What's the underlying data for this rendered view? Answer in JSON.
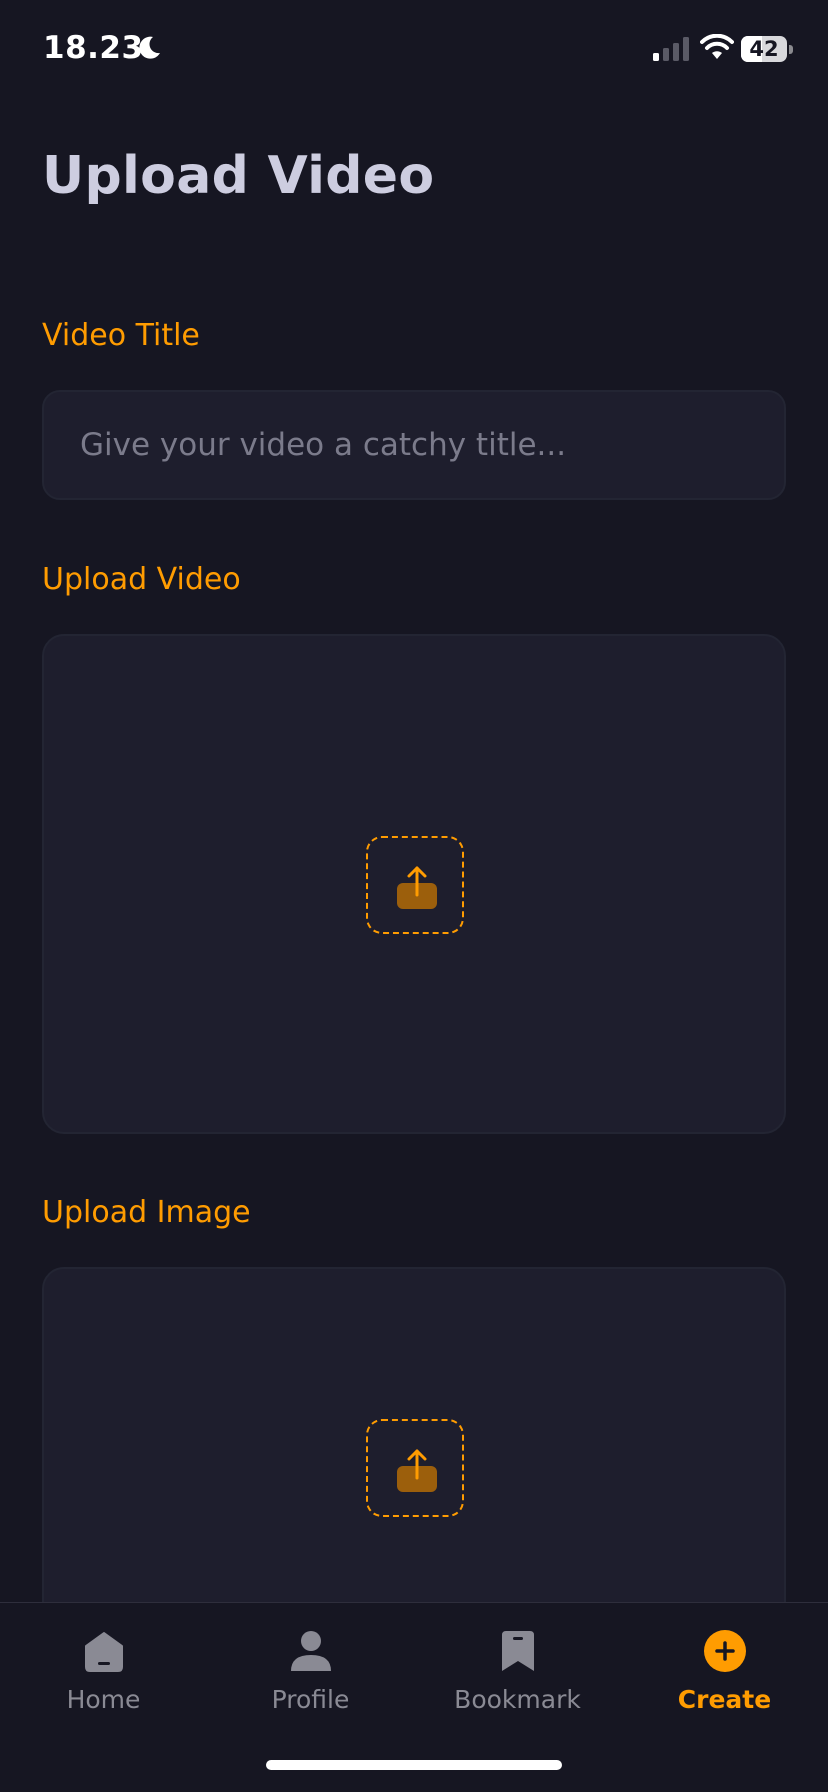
{
  "status_bar": {
    "time": "18.23",
    "battery_level": "42",
    "icons": [
      "moon-icon",
      "cellular-signal-icon",
      "wifi-icon",
      "battery-icon"
    ]
  },
  "page": {
    "title": "Upload Video"
  },
  "form": {
    "video_title_label": "Video Title",
    "video_title_placeholder": "Give your video a catchy title...",
    "video_title_value": "",
    "upload_video_label": "Upload Video",
    "upload_image_label": "Upload Image",
    "upload_icon": "upload-icon"
  },
  "tab_bar": {
    "items": [
      {
        "label": "Home",
        "icon": "home-icon",
        "active": false
      },
      {
        "label": "Profile",
        "icon": "profile-icon",
        "active": false
      },
      {
        "label": "Bookmark",
        "icon": "bookmark-icon",
        "active": false
      },
      {
        "label": "Create",
        "icon": "plus-circle-icon",
        "active": true
      }
    ]
  },
  "colors": {
    "background": "#161622",
    "accent": "#ff9c01",
    "field_background": "#1e1e2d",
    "title_text": "#cdcde0",
    "inactive_tab": "#8a8a94"
  }
}
